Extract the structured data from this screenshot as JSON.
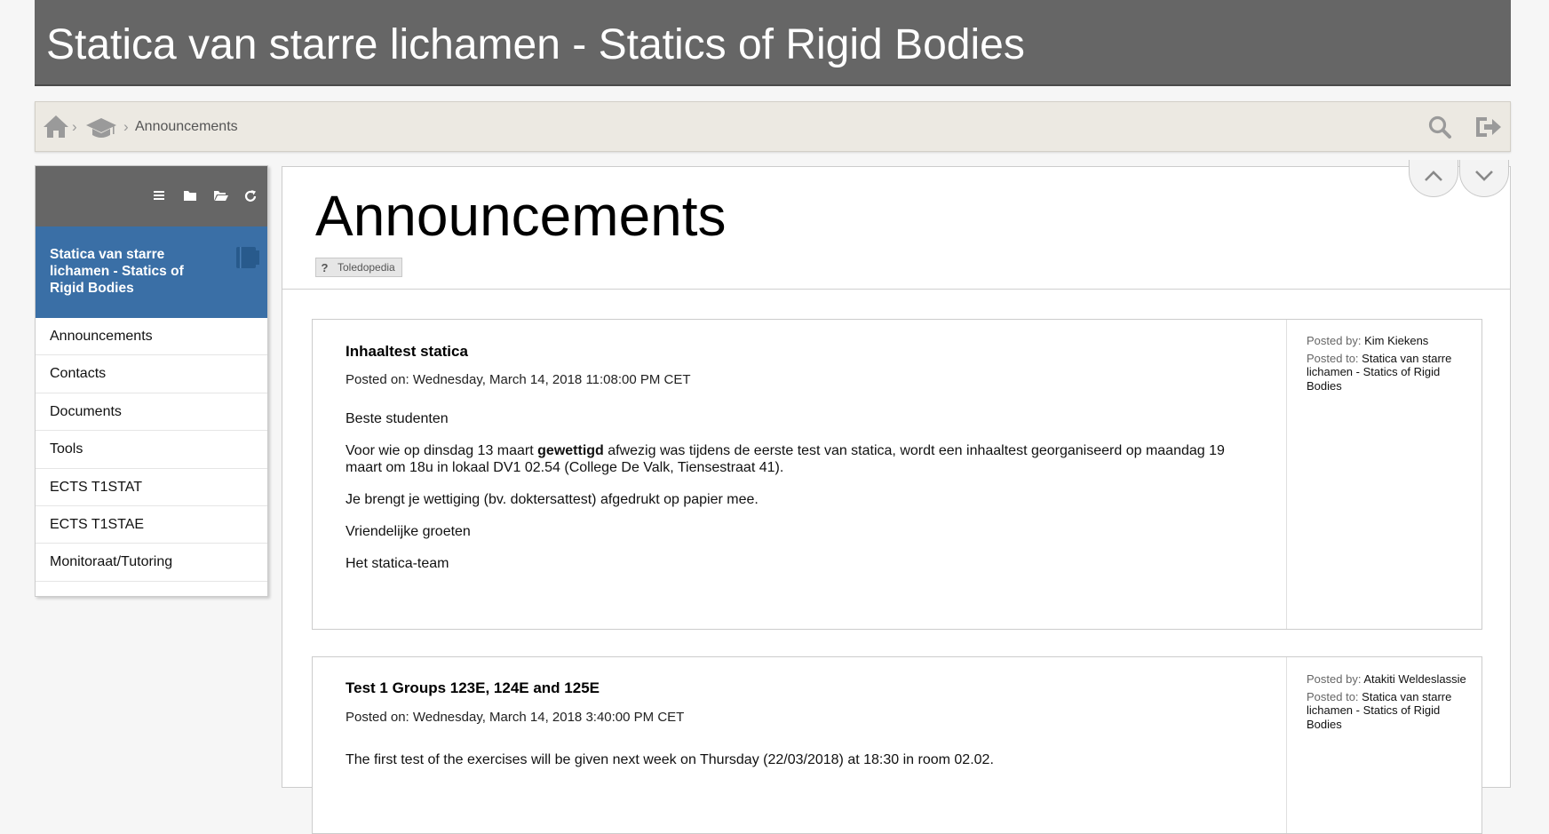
{
  "header": {
    "course_title": "Statica van starre lichamen - Statics of Rigid Bodies"
  },
  "breadcrumb": {
    "separator": "›",
    "current": "Announcements",
    "icons": [
      "home-icon",
      "graduation-cap-icon"
    ]
  },
  "top_actions": {
    "icons": [
      "search-icon",
      "logout-icon"
    ]
  },
  "sidebar": {
    "toolbar_icons": [
      "list-icon",
      "folder-icon",
      "folder-open-icon",
      "refresh-icon"
    ],
    "course_name": "Statica van starre lichamen - Statics of Rigid Bodies",
    "course_icon": "book-icon",
    "items": [
      {
        "label": "Announcements"
      },
      {
        "label": "Contacts"
      },
      {
        "label": "Documents"
      },
      {
        "label": "Tools"
      },
      {
        "label": "ECTS T1STAT"
      },
      {
        "label": "ECTS T1STAE"
      },
      {
        "label": "Monitoraat/Tutoring"
      }
    ]
  },
  "main": {
    "title": "Announcements",
    "help_badge": {
      "icon_text": "?",
      "label": "Toledopedia"
    },
    "nav_icons": [
      "chevron-up-icon",
      "chevron-down-icon"
    ],
    "announcements": [
      {
        "title": "Inhaaltest statica",
        "posted_on": "Posted on: Wednesday, March 14, 2018 11:08:00 PM CET",
        "paragraphs": [
          {
            "text": "Beste studenten"
          },
          {
            "before": "Voor wie op dinsdag 13 maart ",
            "bold": "gewettigd",
            "after": " afwezig was tijdens de eerste test van statica, wordt een inhaaltest georganiseerd op maandag 19 maart om 18u in lokaal DV1 02.54 (College De Valk, Tiensestraat 41)."
          },
          {
            "text": "Je brengt je wettiging (bv. doktersattest) afgedrukt op papier mee."
          },
          {
            "text": "Vriendelijke groeten"
          },
          {
            "text": "Het statica-team"
          }
        ],
        "posted_by_label": "Posted by:",
        "posted_by": "Kim Kiekens",
        "posted_to_label": "Posted to:",
        "posted_to": "Statica van starre lichamen - Statics of Rigid Bodies"
      },
      {
        "title": "Test 1 Groups 123E, 124E and 125E",
        "posted_on": "Posted on: Wednesday, March 14, 2018 3:40:00 PM CET",
        "paragraphs": [
          {
            "text": "The first test of the exercises will be given next week  on Thursday (22/03/2018) at 18:30 in room 02.02."
          }
        ],
        "posted_by_label": "Posted by:",
        "posted_by": "Atakiti Weldeslassie",
        "posted_to_label": "Posted to:",
        "posted_to": "Statica van starre lichamen - Statics of Rigid Bodies"
      }
    ]
  },
  "colors": {
    "header_bg": "#666666",
    "breadcrumb_bg": "#ece9e2",
    "sidebar_active_bg": "#3a6fa6",
    "icon_gray": "#9a9a9a"
  }
}
